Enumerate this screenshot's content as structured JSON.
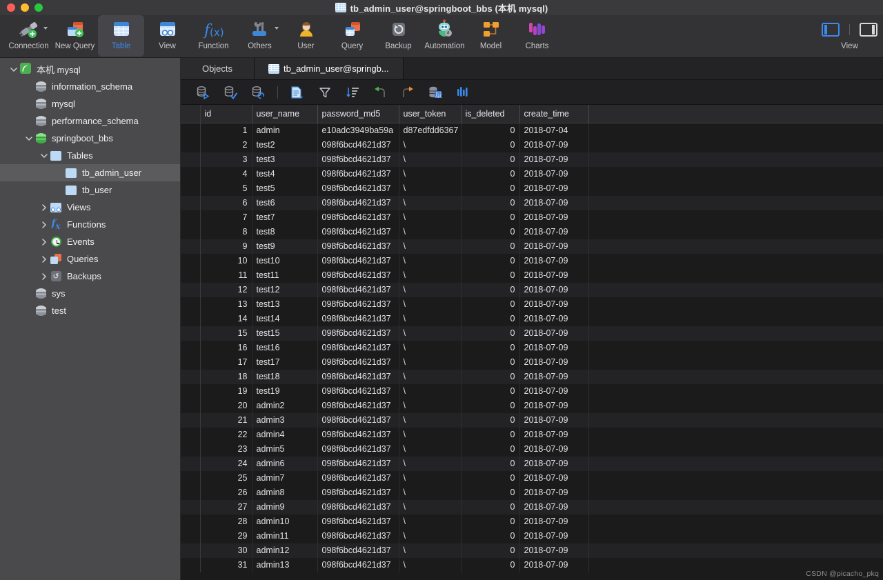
{
  "window": {
    "title": "tb_admin_user@springboot_bbs (本机 mysql)",
    "title_icon": "table-icon",
    "traffic_lights": [
      "close-button",
      "minimize-button",
      "zoom-button"
    ]
  },
  "toolbar": {
    "items": [
      {
        "label": "Connection",
        "icon": "connection-plug-icon",
        "active": false,
        "has_caret": true
      },
      {
        "label": "New Query",
        "icon": "new-query-icon",
        "active": false,
        "has_caret": false
      },
      {
        "label": "Table",
        "icon": "table-icon",
        "active": true,
        "has_caret": false
      },
      {
        "label": "View",
        "icon": "view-icon",
        "active": false,
        "has_caret": false
      },
      {
        "label": "Function",
        "icon": "function-fx-icon",
        "active": false,
        "has_caret": false
      },
      {
        "label": "Others",
        "icon": "others-tools-icon",
        "active": false,
        "has_caret": true
      },
      {
        "label": "User",
        "icon": "user-icon",
        "active": false,
        "has_caret": false
      },
      {
        "label": "Query",
        "icon": "query-icon",
        "active": false,
        "has_caret": false
      },
      {
        "label": "Backup",
        "icon": "backup-restore-icon",
        "active": false,
        "has_caret": false
      },
      {
        "label": "Automation",
        "icon": "automation-robot-icon",
        "active": false,
        "has_caret": false
      },
      {
        "label": "Model",
        "icon": "model-diagram-icon",
        "active": false,
        "has_caret": false
      },
      {
        "label": "Charts",
        "icon": "charts-bars-icon",
        "active": false,
        "has_caret": false
      }
    ],
    "view_group": {
      "label": "View",
      "left_panel_icon": "sidebar-left-toggle-icon",
      "right_panel_icon": "sidebar-right-toggle-icon",
      "left_selected": true,
      "right_selected": false
    }
  },
  "sidebar": {
    "items": [
      {
        "label": "本机 mysql",
        "icon": "connection-leaf-icon",
        "depth": 0,
        "twisty": "down",
        "selected": false
      },
      {
        "label": "information_schema",
        "icon": "database-grey-icon",
        "depth": 1,
        "twisty": "none",
        "selected": false
      },
      {
        "label": "mysql",
        "icon": "database-grey-icon",
        "depth": 1,
        "twisty": "none",
        "selected": false
      },
      {
        "label": "performance_schema",
        "icon": "database-grey-icon",
        "depth": 1,
        "twisty": "none",
        "selected": false
      },
      {
        "label": "springboot_bbs",
        "icon": "database-green-icon",
        "depth": 1,
        "twisty": "down",
        "selected": false
      },
      {
        "label": "Tables",
        "icon": "tables-folder-icon",
        "depth": 2,
        "twisty": "down",
        "selected": false
      },
      {
        "label": "tb_admin_user",
        "icon": "table-icon",
        "depth": 3,
        "twisty": "none",
        "selected": true
      },
      {
        "label": "tb_user",
        "icon": "table-icon",
        "depth": 3,
        "twisty": "none",
        "selected": false
      },
      {
        "label": "Views",
        "icon": "views-icon",
        "depth": 2,
        "twisty": "right",
        "selected": false
      },
      {
        "label": "Functions",
        "icon": "function-fx-icon",
        "depth": 2,
        "twisty": "right",
        "selected": false
      },
      {
        "label": "Events",
        "icon": "events-clock-icon",
        "depth": 2,
        "twisty": "right",
        "selected": false
      },
      {
        "label": "Queries",
        "icon": "queries-icon",
        "depth": 2,
        "twisty": "right",
        "selected": false
      },
      {
        "label": "Backups",
        "icon": "backups-icon",
        "depth": 2,
        "twisty": "right",
        "selected": false
      },
      {
        "label": "sys",
        "icon": "database-grey-icon",
        "depth": 1,
        "twisty": "none",
        "selected": false
      },
      {
        "label": "test",
        "icon": "database-grey-icon",
        "depth": 1,
        "twisty": "none",
        "selected": false
      }
    ]
  },
  "tabs": [
    {
      "label": "Objects",
      "icon": null,
      "active": false
    },
    {
      "label": "tb_admin_user@springb...",
      "icon": "table-icon",
      "active": true
    }
  ],
  "subtoolbar": {
    "buttons": [
      {
        "name": "begin-transaction-icon",
        "label": "Begin Transaction"
      },
      {
        "name": "commit-transaction-icon",
        "label": "Commit"
      },
      {
        "name": "rollback-transaction-icon",
        "label": "Rollback"
      },
      {
        "name": "divider",
        "label": ""
      },
      {
        "name": "form-view-icon",
        "label": "Form View"
      },
      {
        "name": "filter-icon",
        "label": "Filter"
      },
      {
        "name": "sort-icon",
        "label": "Sort"
      },
      {
        "name": "undo-icon",
        "label": "Undo"
      },
      {
        "name": "redo-icon",
        "label": "Redo"
      },
      {
        "name": "raw-data-icon",
        "label": "Raw Data"
      },
      {
        "name": "chart-preview-icon",
        "label": "Chart"
      }
    ]
  },
  "grid": {
    "columns": [
      "id",
      "user_name",
      "password_md5",
      "user_token",
      "is_deleted",
      "create_time"
    ],
    "rows": [
      [
        "1",
        "admin",
        "e10adc3949ba59a",
        "d87edfdd6367",
        "0",
        "2018-07-04"
      ],
      [
        "2",
        "test2",
        "098f6bcd4621d37",
        "\\",
        "0",
        "2018-07-09"
      ],
      [
        "3",
        "test3",
        "098f6bcd4621d37",
        "\\",
        "0",
        "2018-07-09"
      ],
      [
        "4",
        "test4",
        "098f6bcd4621d37",
        "\\",
        "0",
        "2018-07-09"
      ],
      [
        "5",
        "test5",
        "098f6bcd4621d37",
        "\\",
        "0",
        "2018-07-09"
      ],
      [
        "6",
        "test6",
        "098f6bcd4621d37",
        "\\",
        "0",
        "2018-07-09"
      ],
      [
        "7",
        "test7",
        "098f6bcd4621d37",
        "\\",
        "0",
        "2018-07-09"
      ],
      [
        "8",
        "test8",
        "098f6bcd4621d37",
        "\\",
        "0",
        "2018-07-09"
      ],
      [
        "9",
        "test9",
        "098f6bcd4621d37",
        "\\",
        "0",
        "2018-07-09"
      ],
      [
        "10",
        "test10",
        "098f6bcd4621d37",
        "\\",
        "0",
        "2018-07-09"
      ],
      [
        "11",
        "test11",
        "098f6bcd4621d37",
        "\\",
        "0",
        "2018-07-09"
      ],
      [
        "12",
        "test12",
        "098f6bcd4621d37",
        "\\",
        "0",
        "2018-07-09"
      ],
      [
        "13",
        "test13",
        "098f6bcd4621d37",
        "\\",
        "0",
        "2018-07-09"
      ],
      [
        "14",
        "test14",
        "098f6bcd4621d37",
        "\\",
        "0",
        "2018-07-09"
      ],
      [
        "15",
        "test15",
        "098f6bcd4621d37",
        "\\",
        "0",
        "2018-07-09"
      ],
      [
        "16",
        "test16",
        "098f6bcd4621d37",
        "\\",
        "0",
        "2018-07-09"
      ],
      [
        "17",
        "test17",
        "098f6bcd4621d37",
        "\\",
        "0",
        "2018-07-09"
      ],
      [
        "18",
        "test18",
        "098f6bcd4621d37",
        "\\",
        "0",
        "2018-07-09"
      ],
      [
        "19",
        "test19",
        "098f6bcd4621d37",
        "\\",
        "0",
        "2018-07-09"
      ],
      [
        "20",
        "admin2",
        "098f6bcd4621d37",
        "\\",
        "0",
        "2018-07-09"
      ],
      [
        "21",
        "admin3",
        "098f6bcd4621d37",
        "\\",
        "0",
        "2018-07-09"
      ],
      [
        "22",
        "admin4",
        "098f6bcd4621d37",
        "\\",
        "0",
        "2018-07-09"
      ],
      [
        "23",
        "admin5",
        "098f6bcd4621d37",
        "\\",
        "0",
        "2018-07-09"
      ],
      [
        "24",
        "admin6",
        "098f6bcd4621d37",
        "\\",
        "0",
        "2018-07-09"
      ],
      [
        "25",
        "admin7",
        "098f6bcd4621d37",
        "\\",
        "0",
        "2018-07-09"
      ],
      [
        "26",
        "admin8",
        "098f6bcd4621d37",
        "\\",
        "0",
        "2018-07-09"
      ],
      [
        "27",
        "admin9",
        "098f6bcd4621d37",
        "\\",
        "0",
        "2018-07-09"
      ],
      [
        "28",
        "admin10",
        "098f6bcd4621d37",
        "\\",
        "0",
        "2018-07-09"
      ],
      [
        "29",
        "admin11",
        "098f6bcd4621d37",
        "\\",
        "0",
        "2018-07-09"
      ],
      [
        "30",
        "admin12",
        "098f6bcd4621d37",
        "\\",
        "0",
        "2018-07-09"
      ],
      [
        "31",
        "admin13",
        "098f6bcd4621d37",
        "\\",
        "0",
        "2018-07-09"
      ]
    ]
  },
  "watermark": "CSDN @picacho_pkq",
  "colors": {
    "accent": "#3b8aed",
    "titlebar_bg": "#3a3a3c",
    "toolbar_bg": "#333335",
    "sidebar_bg": "#4a4a4c",
    "grid_bg": "#1b1b1c",
    "grid_alt_row": "#232325",
    "header_bg": "#2a2a2c"
  }
}
